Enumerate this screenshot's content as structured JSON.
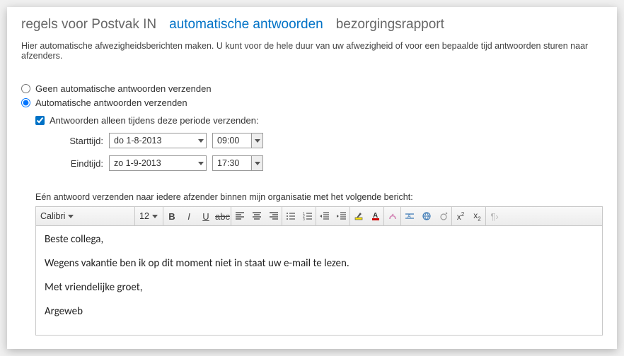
{
  "tabs": {
    "inbox_rules": "regels voor Postvak IN",
    "auto_replies": "automatische antwoorden",
    "delivery_report": "bezorgingsrapport"
  },
  "intro": "Hier automatische afwezigheidsberichten maken. U kunt voor de hele duur van uw afwezigheid of voor een bepaalde tijd antwoorden sturen naar afzenders.",
  "radios": {
    "off": "Geen automatische antwoorden verzenden",
    "on": "Automatische antwoorden verzenden"
  },
  "period_checkbox": "Antwoorden alleen tijdens deze periode verzenden:",
  "labels": {
    "start": "Starttijd:",
    "end": "Eindtijd:"
  },
  "start": {
    "date": "do 1-8-2013",
    "time": "09:00"
  },
  "end": {
    "date": "zo 1-9-2013",
    "time": "17:30"
  },
  "section_label": "Eén antwoord verzenden naar iedere afzender binnen mijn organisatie met het volgende bericht:",
  "editor_toolbar": {
    "font": "Calibri",
    "size": "12"
  },
  "message": {
    "l1": "Beste collega,",
    "l2": "Wegens vakantie ben ik op dit moment niet in staat uw e-mail te lezen.",
    "l3": "Met vriendelijke groet,",
    "l4": "Argeweb"
  }
}
